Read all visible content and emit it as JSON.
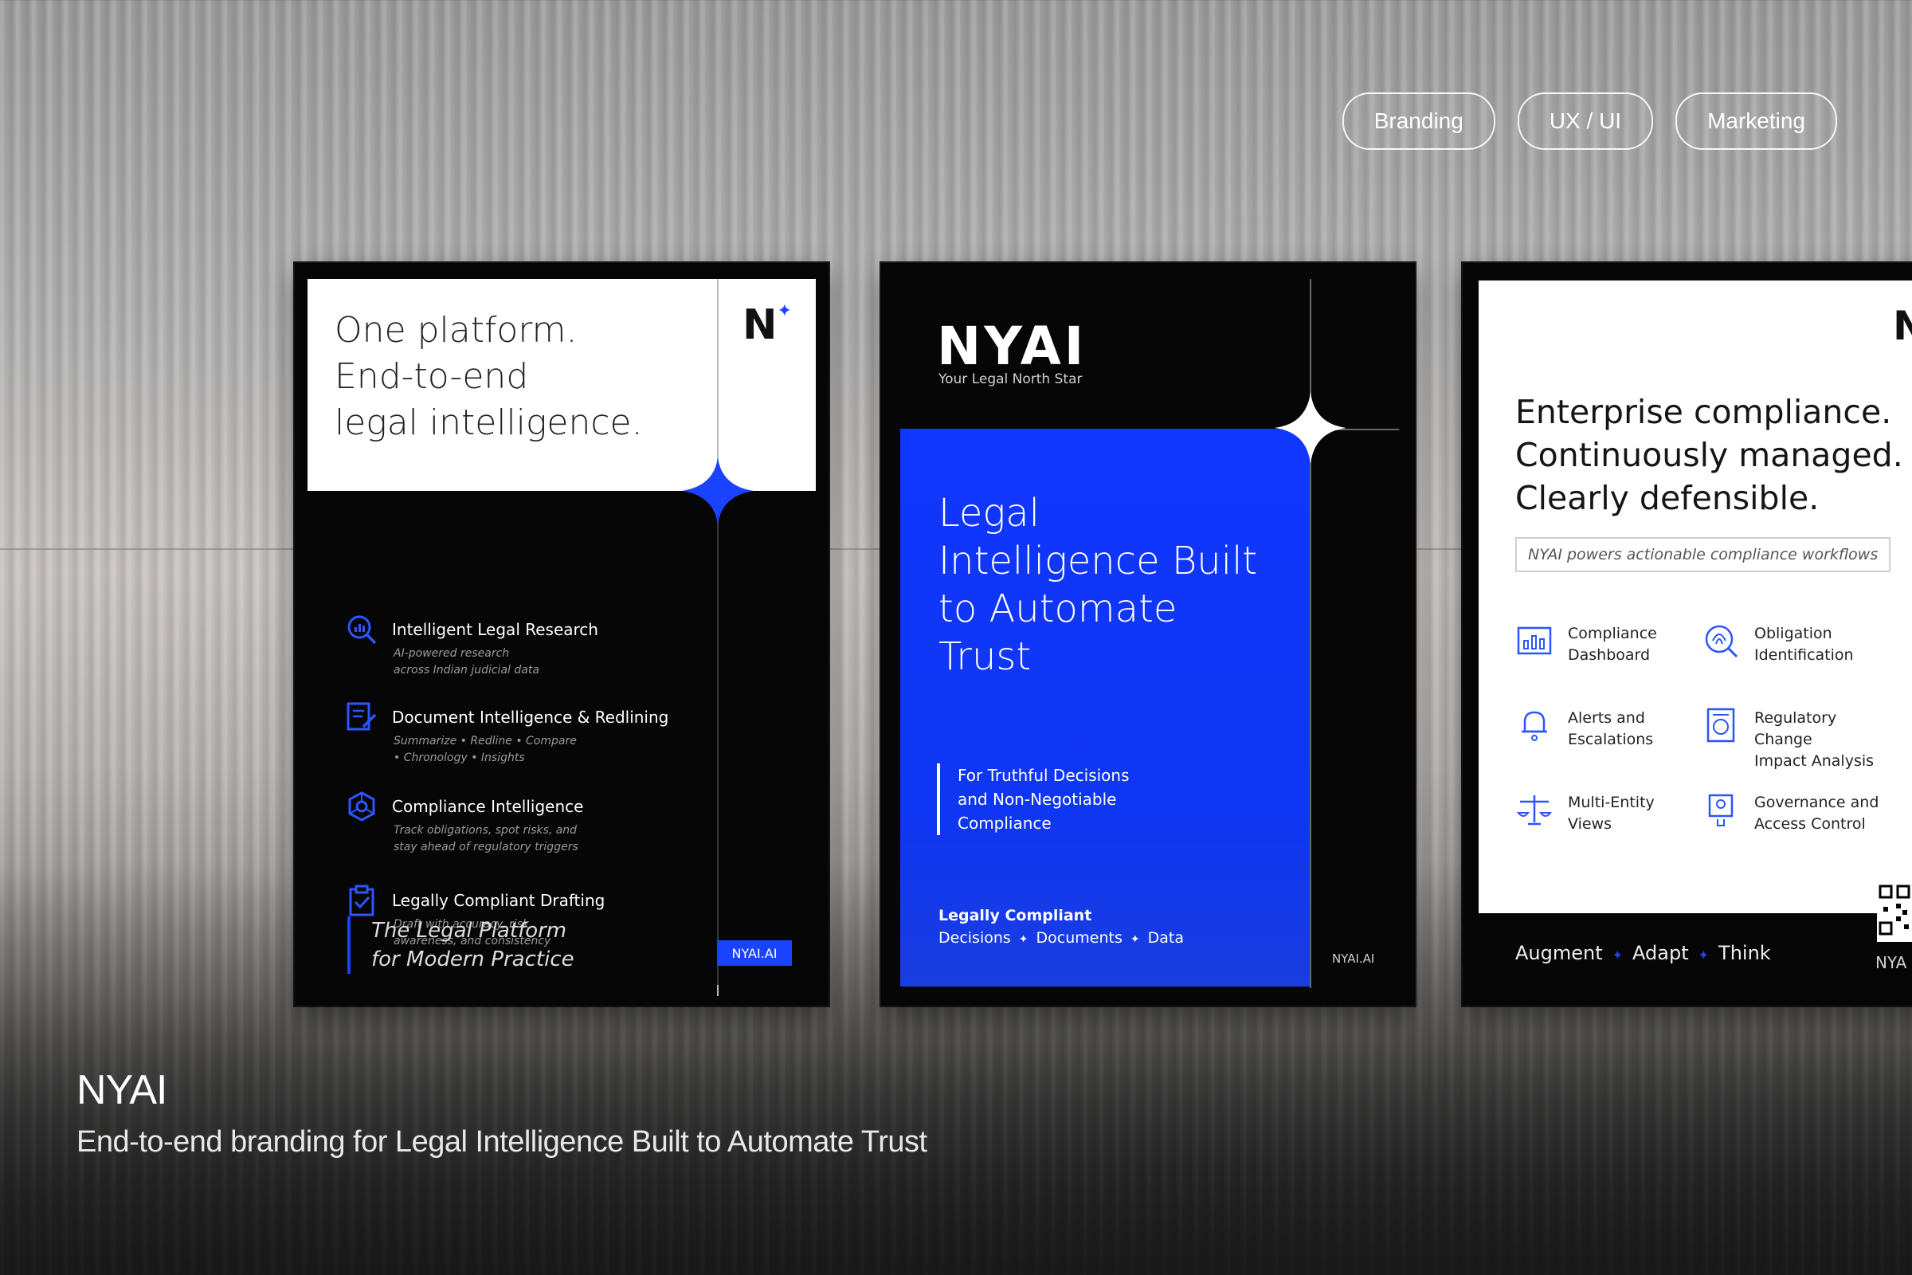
{
  "tags": [
    "Branding",
    "UX / UI",
    "Marketing"
  ],
  "poster1": {
    "logo": "N",
    "headline": [
      "One platform.",
      "End-to-end",
      "legal intelligence."
    ],
    "features": [
      {
        "title": "Intelligent Legal Research",
        "sub": [
          "AI-powered research",
          "across Indian judicial data"
        ],
        "icon": "search-chart-icon"
      },
      {
        "title": "Document Intelligence & Redlining",
        "sub": [
          "Summarize • Redline • Compare",
          "• Chronology • Insights"
        ],
        "icon": "document-edit-icon"
      },
      {
        "title": "Compliance Intelligence",
        "sub": [
          "Track obligations, spot risks, and",
          "stay ahead of regulatory triggers"
        ],
        "icon": "compliance-network-icon"
      },
      {
        "title": "Legally Compliant Drafting",
        "sub": [
          "Draft with accuracy, risk",
          "awareness, and consistency"
        ],
        "icon": "clipboard-check-icon"
      }
    ],
    "tagline": [
      "The Legal Platform",
      "for Modern Practice"
    ],
    "badge": "NYAI.AI"
  },
  "poster2": {
    "logo": "NYAI",
    "subtitle": "Your Legal North Star",
    "title": [
      "Legal",
      "Intelligence Built",
      "to Automate",
      "Trust"
    ],
    "quote": [
      "For Truthful Decisions",
      "and Non-Negotiable",
      "Compliance"
    ],
    "foot_title": "Legally Compliant",
    "foot_items": [
      "Decisions",
      "Documents",
      "Data"
    ],
    "badge": "NYAI.AI"
  },
  "poster3": {
    "logo": "N",
    "headline": [
      "Enterprise compliance.",
      "Continuously managed.",
      "Clearly defensible."
    ],
    "box": "NYAI powers actionable compliance workflows",
    "items": [
      {
        "label": [
          "Compliance",
          "Dashboard"
        ],
        "icon": "dashboard-chart-icon"
      },
      {
        "label": [
          "Obligation",
          "Identification"
        ],
        "icon": "fingerprint-search-icon"
      },
      {
        "label": [
          "Alerts and",
          "Escalations"
        ],
        "icon": "bell-alert-icon"
      },
      {
        "label": [
          "Regulatory Change",
          "Impact Analysis"
        ],
        "icon": "regulatory-doc-icon"
      },
      {
        "label": [
          "Multi-Entity",
          "Views"
        ],
        "icon": "scales-icon"
      },
      {
        "label": [
          "Governance and",
          "Access Control"
        ],
        "icon": "access-control-icon"
      }
    ],
    "foot_items": [
      "Augment",
      "Adapt",
      "Think"
    ],
    "badge": "NYA"
  },
  "caption": {
    "title": "NYAI",
    "subtitle": "End-to-end branding for Legal Intelligence Built to Automate Trust"
  },
  "colors": {
    "accent": "#1a43ff",
    "poster_dark": "#060606"
  }
}
